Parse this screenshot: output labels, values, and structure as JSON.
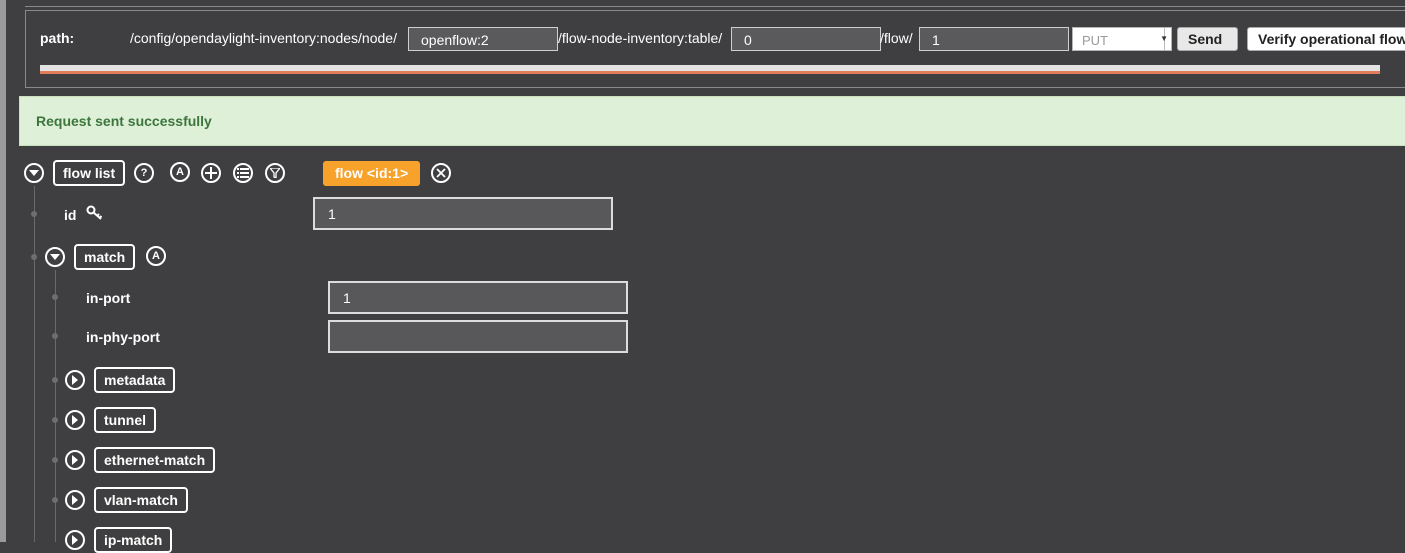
{
  "path_bar": {
    "label": "path:",
    "segment_1": "/config/opendaylight-inventory:nodes/node/",
    "node_value": "openflow:2",
    "segment_2": "/flow-node-inventory:table/",
    "table_value": "0",
    "segment_3": "/flow/",
    "flow_value": "1",
    "method_selected": "PUT",
    "send_label": "Send",
    "verify_label": "Verify operational flow",
    "progress": 1.0
  },
  "alert": {
    "message": "Request sent successfully"
  },
  "tree": {
    "list_label": "flow list",
    "letter_a": "A",
    "selected_item": "flow  <id:1>",
    "id_label": "id",
    "id_value": "1",
    "match_label": "match",
    "match_letter": "A",
    "in_port_label": "in-port",
    "in_port_value": "1",
    "in_phy_port_label": "in-phy-port",
    "in_phy_port_value": "",
    "children": [
      {
        "label": "metadata"
      },
      {
        "label": "tunnel"
      },
      {
        "label": "ethernet-match"
      },
      {
        "label": "vlan-match"
      },
      {
        "label": "ip-match"
      }
    ]
  },
  "colors": {
    "background": "#3f3f41",
    "success_bg": "#dff0d8",
    "success_text": "#3c763d",
    "accent_orange": "#f7a22b",
    "progress": "#e27d5c"
  }
}
